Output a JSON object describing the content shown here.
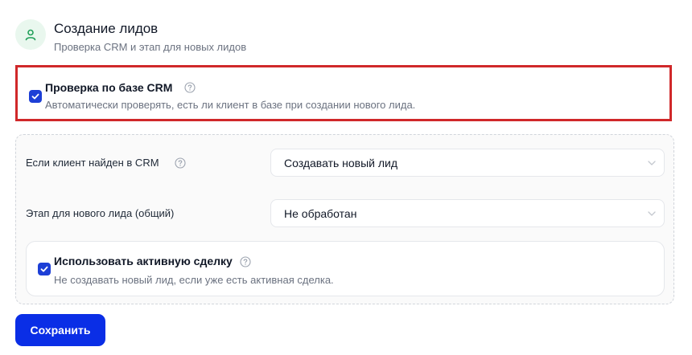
{
  "header": {
    "title": "Создание лидов",
    "subtitle": "Проверка CRM и этап для новых лидов",
    "icon": "user-icon",
    "accent_color": "#22a05a"
  },
  "crm_check": {
    "checked": true,
    "label": "Проверка по базе CRM",
    "description": "Автоматически проверять, есть ли клиент в базе при создании нового лида.",
    "highlight_color": "#d0282a"
  },
  "settings": {
    "client_found": {
      "label": "Если клиент найден в CRM",
      "value": "Создавать новый лид"
    },
    "new_lead_stage": {
      "label": "Этап для нового лида (общий)",
      "value": "Не обработан"
    },
    "active_deal": {
      "checked": true,
      "label": "Использовать активную сделку",
      "description": "Не создавать новый лид, если уже есть активная сделка."
    }
  },
  "actions": {
    "save_label": "Сохранить",
    "primary_color": "#0a2ee6"
  }
}
